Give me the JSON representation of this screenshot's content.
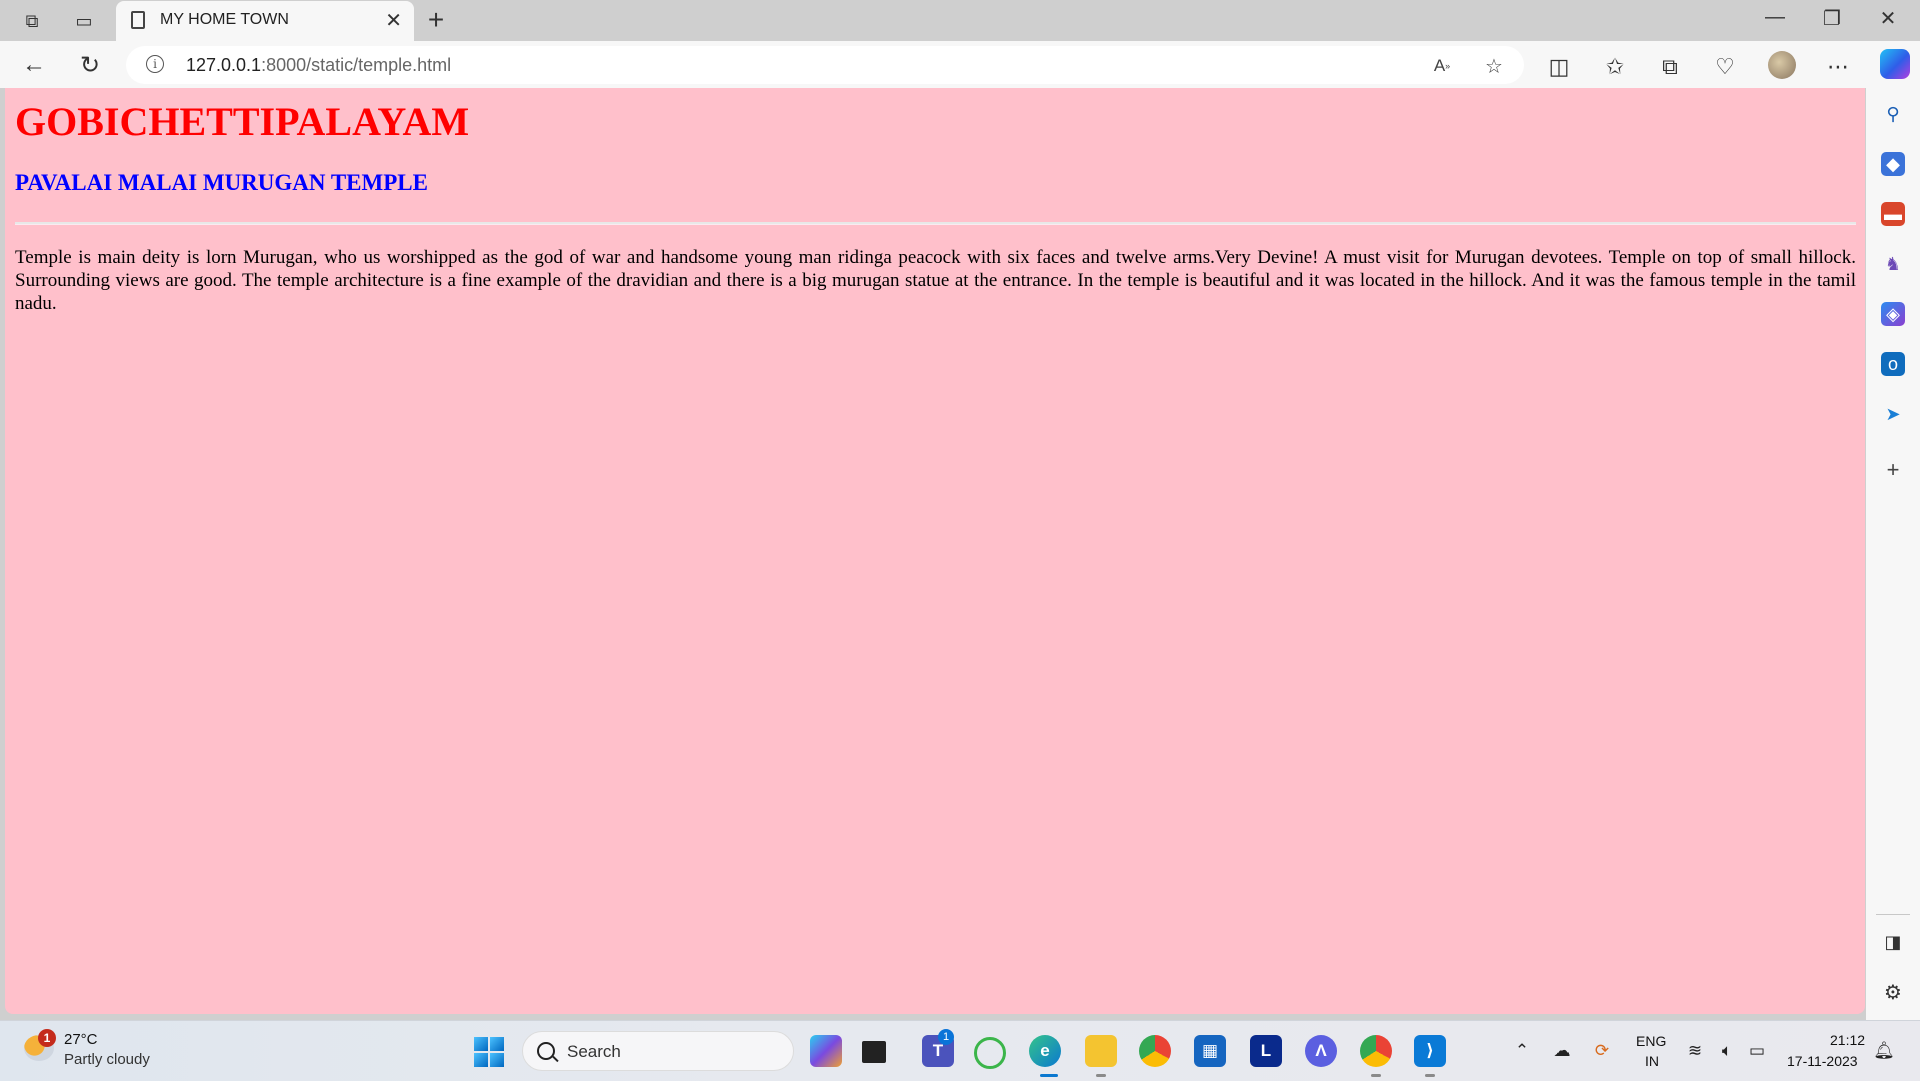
{
  "browser": {
    "tab_title": "MY HOME TOWN",
    "tab_close": "✕",
    "new_tab": "+",
    "url_host": "127.0.0.1",
    "url_path": ":8000/static/temple.html",
    "window_controls": {
      "minimize": "—",
      "restore": "❐",
      "close": "✕"
    },
    "icons": {
      "workspaces": "workspaces-icon",
      "tab_actions": "tab-actions-icon",
      "back": "back-arrow-icon",
      "refresh": "refresh-icon",
      "info": "info-icon",
      "read_aloud": "read-aloud-icon",
      "favorite": "star-icon",
      "split_screen": "split-screen-icon",
      "favorites": "favorites-icon",
      "collections": "collections-icon",
      "browser_essentials": "browser-essentials-icon",
      "more": "more-icon",
      "copilot": "copilot-icon"
    }
  },
  "page": {
    "heading": "GOBICHETTIPALAYAM",
    "subheading": "PAVALAI MALAI MURUGAN TEMPLE",
    "paragraph": "Temple is main deity is lorn Murugan, who us worshipped as the god of war and handsome young man ridinga peacock with six faces and twelve arms.Very Devine! A must visit for Murugan devotees. Temple on top of small hillock. Surrounding views are good. The temple architecture is a fine example of the dravidian and there is a big murugan statue at the entrance. In the temple is beautiful and it was located in the hillock. And it was the famous temple in the tamil nadu.",
    "background_color": "#ffc0cb",
    "heading_color": "#ff0000",
    "subheading_color": "#0000ff"
  },
  "sidebar": {
    "items": [
      "search-icon",
      "shopping-tag-icon",
      "tools-icon",
      "games-icon",
      "microsoft-365-icon",
      "outlook-icon",
      "send-icon",
      "add-icon",
      "hide-sidebar-icon",
      "settings-icon"
    ]
  },
  "taskbar": {
    "weather_badge": "1",
    "temperature": "27°C",
    "weather": "Partly cloudy",
    "search_placeholder": "Search",
    "apps": [
      "copilot-app-icon",
      "task-view-icon",
      "teams-icon",
      "refresh-app-icon",
      "edge-icon",
      "file-explorer-icon",
      "chrome-icon",
      "store-icon",
      "l-app-icon",
      "arc-app-icon",
      "chrome-profile-icon",
      "vscode-icon"
    ],
    "teams_badge": "1",
    "language_line1": "ENG",
    "language_line2": "IN",
    "time": "21:12",
    "date": "17-11-2023"
  }
}
